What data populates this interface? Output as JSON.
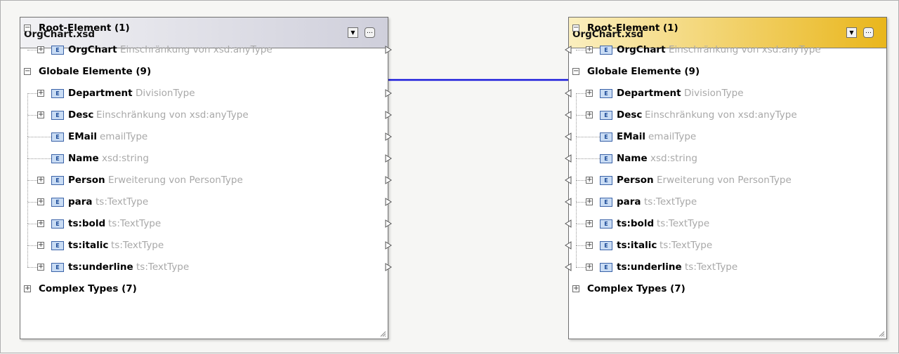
{
  "left": {
    "title": "OrgChart.xsd",
    "menu_icon": "dropdown-icon",
    "more_icon": "ellipsis-icon",
    "root_label": "Root-Element (1)",
    "root_item": {
      "name": "OrgChart",
      "type": "Einschränkung von xsd:anyType"
    },
    "global_label": "Globale Elemente (9)",
    "globals": [
      {
        "name": "Department",
        "type": "DivisionType",
        "expand": true
      },
      {
        "name": "Desc",
        "type": "Einschränkung von xsd:anyType",
        "expand": true
      },
      {
        "name": "EMail",
        "type": "emailType",
        "expand": false
      },
      {
        "name": "Name",
        "type": "xsd:string",
        "expand": false
      },
      {
        "name": "Person",
        "type": "Erweiterung von PersonType",
        "expand": true
      },
      {
        "name": "para",
        "type": "ts:TextType",
        "expand": true
      },
      {
        "name": "ts:bold",
        "type": "ts:TextType",
        "expand": true
      },
      {
        "name": "ts:italic",
        "type": "ts:TextType",
        "expand": true
      },
      {
        "name": "ts:underline",
        "type": "ts:TextType",
        "expand": true
      }
    ],
    "complex_label": "Complex Types (7)"
  },
  "right": {
    "title": "OrgChart.xsd",
    "menu_icon": "dropdown-icon",
    "more_icon": "ellipsis-icon",
    "root_label": "Root-Element (1)",
    "root_item": {
      "name": "OrgChart",
      "type": "Einschränkung von xsd:anyType"
    },
    "global_label": "Globale Elemente (9)",
    "globals": [
      {
        "name": "Department",
        "type": "DivisionType",
        "expand": true
      },
      {
        "name": "Desc",
        "type": "Einschränkung von xsd:anyType",
        "expand": true
      },
      {
        "name": "EMail",
        "type": "emailType",
        "expand": false
      },
      {
        "name": "Name",
        "type": "xsd:string",
        "expand": false
      },
      {
        "name": "Person",
        "type": "Erweiterung von PersonType",
        "expand": true
      },
      {
        "name": "para",
        "type": "ts:TextType",
        "expand": true
      },
      {
        "name": "ts:bold",
        "type": "ts:TextType",
        "expand": true
      },
      {
        "name": "ts:italic",
        "type": "ts:TextType",
        "expand": true
      },
      {
        "name": "ts:underline",
        "type": "ts:TextType",
        "expand": true
      }
    ],
    "complex_label": "Complex Types (7)"
  },
  "element_badge": "E",
  "expand_glyph": "+",
  "collapse_glyph": "−",
  "connection": {
    "from": "left.root_item",
    "to": "right.root_item",
    "color": "#1a1adb"
  },
  "colors": {
    "type_text": "#a8a8a8",
    "link": "#1a1adb",
    "left_header": "#cfcfdb",
    "right_header": "#e9b61c"
  }
}
